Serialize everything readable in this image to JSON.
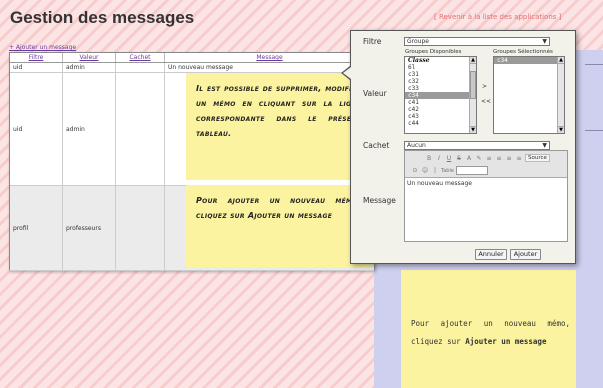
{
  "header": {
    "title": "Gestion des messages",
    "back_link": "[ Revenir à la liste des applications ]",
    "add_link": "+ Ajouter un message"
  },
  "table": {
    "columns": [
      "Filtre",
      "Valeur",
      "Cachet",
      "Message"
    ],
    "rows": [
      {
        "filtre": "uid",
        "valeur": "admin",
        "cachet": "",
        "message": "Un nouveau message"
      },
      {
        "filtre": "uid",
        "valeur": "admin",
        "cachet": "",
        "message": "Il est possible de supprimer, modifier un mémo en cliquant sur la ligne correspondante dans le présent tableau."
      },
      {
        "filtre": "profil",
        "valeur": "professeurs",
        "cachet": "",
        "message": "Pour ajouter un nouveau mémo, cliquez sur Ajouter un message"
      }
    ]
  },
  "popup": {
    "filtre_label": "Filtre",
    "filtre_value": "Groupe",
    "valeur_label": "Valeur",
    "available_title": "Groupes Disponibles",
    "selected_title": "Groupes Sélectionnés",
    "available_items": [
      "Classe",
      "6l",
      "c31",
      "c32",
      "c33",
      "c34",
      "c41",
      "c42",
      "c43",
      "c44"
    ],
    "available_header_index": 0,
    "available_selected_index": 5,
    "selected_items": [
      "c34"
    ],
    "add_button": ">",
    "remove_button": "<<",
    "cachet_label": "Cachet",
    "cachet_value": "Aucun",
    "message_label": "Message",
    "editor_content": "Un nouveau message",
    "editor_source_label": "Source",
    "editor_table_label": "Table",
    "cancel_button": "Annuler",
    "save_button": "Ajouter"
  },
  "preview_note": {
    "text_prefix": "Pour ajouter un nouveau mémo, cliquez sur ",
    "text_bold": "Ajouter un message"
  },
  "colors": {
    "note_yellow": "#fbf3a0",
    "link_purple": "#6a3aa0",
    "back_link_red": "#e07070",
    "column_blue": "#cfd0ef"
  }
}
